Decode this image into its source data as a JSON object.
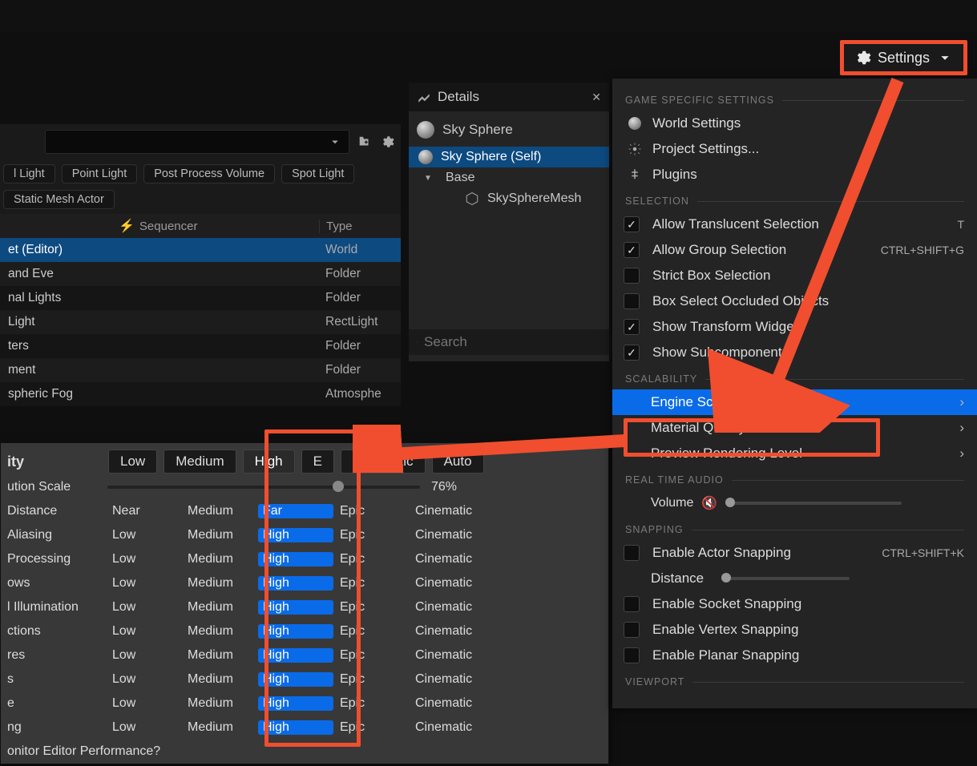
{
  "settingsButton": {
    "label": "Settings"
  },
  "filterPills": [
    "l Light",
    "Point Light",
    "Post Process Volume",
    "Spot Light",
    "Static Mesh Actor"
  ],
  "outlinerHeader": {
    "sequencer": "Sequencer",
    "type": "Type"
  },
  "outlinerRows": [
    {
      "name": "et (Editor)",
      "type": "World",
      "sel": true
    },
    {
      "name": "and Eve",
      "type": "Folder"
    },
    {
      "name": "nal Lights",
      "type": "Folder"
    },
    {
      "name": "Light",
      "type": "RectLight"
    },
    {
      "name": "ters",
      "type": "Folder"
    },
    {
      "name": "ment",
      "type": "Folder"
    },
    {
      "name": "spheric Fog",
      "type": "Atmosphe"
    }
  ],
  "details": {
    "tabTitle": "Details",
    "actorName": "Sky Sphere",
    "components": [
      {
        "label": "Sky Sphere (Self)",
        "sel": true,
        "depth": 0,
        "icon": "sphere"
      },
      {
        "label": "Base",
        "depth": 1,
        "icon": "tri"
      },
      {
        "label": "SkySphereMesh",
        "depth": 2,
        "icon": "cube"
      }
    ],
    "searchPlaceholder": "Search"
  },
  "scalability": {
    "title": "ity",
    "presets": [
      "Low",
      "Medium",
      "High",
      "E",
      "Cinematic",
      "Auto"
    ],
    "activePreset": "High",
    "resolution": {
      "label": "ution Scale",
      "percent": "76%",
      "pos": 76
    },
    "rows": [
      {
        "label": "Distance",
        "opts": [
          "Near",
          "Medium",
          "Far",
          "Epic",
          "Cinematic"
        ],
        "sel": 2
      },
      {
        "label": "Aliasing",
        "opts": [
          "Low",
          "Medium",
          "High",
          "Epic",
          "Cinematic"
        ],
        "sel": 2
      },
      {
        "label": "Processing",
        "opts": [
          "Low",
          "Medium",
          "High",
          "Epic",
          "Cinematic"
        ],
        "sel": 2
      },
      {
        "label": "ows",
        "opts": [
          "Low",
          "Medium",
          "High",
          "Epic",
          "Cinematic"
        ],
        "sel": 2
      },
      {
        "label": "l Illumination",
        "opts": [
          "Low",
          "Medium",
          "High",
          "Epic",
          "Cinematic"
        ],
        "sel": 2
      },
      {
        "label": "ctions",
        "opts": [
          "Low",
          "Medium",
          "High",
          "Epic",
          "Cinematic"
        ],
        "sel": 2
      },
      {
        "label": "res",
        "opts": [
          "Low",
          "Medium",
          "High",
          "Epic",
          "Cinematic"
        ],
        "sel": 2
      },
      {
        "label": "s",
        "opts": [
          "Low",
          "Medium",
          "High",
          "Epic",
          "Cinematic"
        ],
        "sel": 2
      },
      {
        "label": "e",
        "opts": [
          "Low",
          "Medium",
          "High",
          "Epic",
          "Cinematic"
        ],
        "sel": 2
      },
      {
        "label": "ng",
        "opts": [
          "Low",
          "Medium",
          "High",
          "Epic",
          "Cinematic"
        ],
        "sel": 2
      }
    ],
    "monitorLabel": "onitor Editor Performance?"
  },
  "settingsPanel": {
    "gameSpecific": {
      "header": "GAME SPECIFIC SETTINGS",
      "items": [
        "World Settings",
        "Project Settings...",
        "Plugins"
      ]
    },
    "selection": {
      "header": "SELECTION",
      "items": [
        {
          "label": "Allow Translucent Selection",
          "checked": true,
          "shortcut": "T"
        },
        {
          "label": "Allow Group Selection",
          "checked": true,
          "shortcut": "CTRL+SHIFT+G"
        },
        {
          "label": "Strict Box Selection",
          "checked": false
        },
        {
          "label": "Box Select Occluded Objects",
          "checked": false
        },
        {
          "label": "Show Transform Widget",
          "checked": true
        },
        {
          "label": "Show Subcomponents",
          "checked": true
        }
      ]
    },
    "scalability": {
      "header": "SCALABILITY",
      "items": [
        "Engine Scalability Settings",
        "Material Quality Level",
        "Preview Rendering Level"
      ]
    },
    "realTimeAudio": {
      "header": "REAL TIME AUDIO",
      "volumeLabel": "Volume"
    },
    "snapping": {
      "header": "SNAPPING",
      "items": [
        {
          "label": "Enable Actor Snapping",
          "checked": false,
          "shortcut": "CTRL+SHIFT+K"
        },
        {
          "label": "Distance",
          "slider": true
        },
        {
          "label": "Enable Socket Snapping",
          "checked": false
        },
        {
          "label": "Enable Vertex Snapping",
          "checked": false
        },
        {
          "label": "Enable Planar Snapping",
          "checked": false
        }
      ]
    },
    "viewport": {
      "header": "VIEWPORT"
    }
  }
}
